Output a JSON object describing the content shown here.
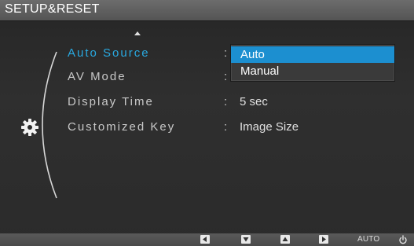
{
  "title": "SETUP&RESET",
  "menu": {
    "items": [
      {
        "label": "Auto Source",
        "value": ""
      },
      {
        "label": "AV Mode",
        "value": ""
      },
      {
        "label": "Display Time",
        "value": "5 sec"
      },
      {
        "label": "Customized Key",
        "value": "Image Size"
      }
    ],
    "colon": ":"
  },
  "dropdown": {
    "options": [
      "Auto",
      "Manual"
    ],
    "selected": "Auto"
  },
  "bottom_bar": {
    "auto_label": "AUTO",
    "buttons": [
      "left-arrow-icon",
      "down-arrow-icon",
      "up-arrow-icon",
      "right-arrow-icon",
      "power-icon"
    ]
  },
  "colors": {
    "accent": "#29a9e0",
    "highlight": "#1c8fd0",
    "background": "#2b2b2b"
  }
}
